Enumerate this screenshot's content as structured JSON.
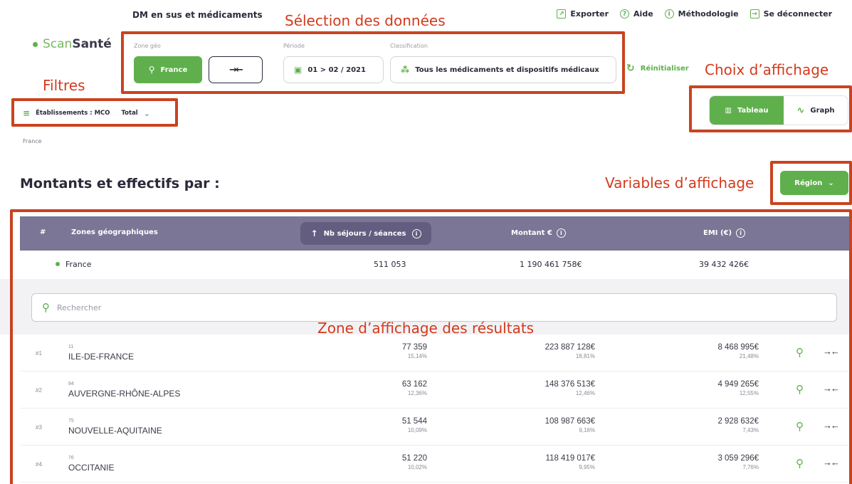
{
  "app": {
    "name": "DM en sus et médicaments",
    "logo_scan": "Scan",
    "logo_sante": "Santé"
  },
  "toplinks": [
    {
      "label": "Exporter",
      "icon": "export-icon"
    },
    {
      "label": "Aide",
      "icon": "help-icon"
    },
    {
      "label": "Méthodologie",
      "icon": "info-icon"
    },
    {
      "label": "Se déconnecter",
      "icon": "logout-icon"
    }
  ],
  "selection": {
    "zone_label": "Zone géo",
    "zone_value": "France",
    "period_label": "Période",
    "period_value": "01 > 02 / 2021",
    "classification_label": "Classification",
    "classification_value": "Tous les médicaments et dispositifs médicaux"
  },
  "reset_label": "Réinitialiser",
  "filters": {
    "establishments": "Établissements : MCO",
    "total": "Total"
  },
  "breadcrumb": "France",
  "view_toggle": {
    "table": "Tableau",
    "graph": "Graph",
    "active": "table"
  },
  "section_title": "Montants et effectifs par :",
  "variable_button": "Région",
  "table": {
    "headers": {
      "rank": "#",
      "zone": "Zones géographiques",
      "stays": "Nb séjours / séances",
      "amount": "Montant €",
      "emi": "EMI (€)"
    },
    "total_row": {
      "zone": "France",
      "stays": "511 053",
      "amount": "1 190 461 758€",
      "emi": "39 432 426€"
    },
    "search_placeholder": "Rechercher",
    "rows": [
      {
        "rank": "#1",
        "code": "11",
        "name": "ILE-DE-FRANCE",
        "stays": "77 359",
        "stays_pct": "15,14%",
        "amount": "223 887 128€",
        "amount_pct": "18,81%",
        "emi": "8 468 995€",
        "emi_pct": "21,48%"
      },
      {
        "rank": "#2",
        "code": "84",
        "name": "AUVERGNE-RHÔNE-ALPES",
        "stays": "63 162",
        "stays_pct": "12,36%",
        "amount": "148 376 513€",
        "amount_pct": "12,46%",
        "emi": "4 949 265€",
        "emi_pct": "12,55%"
      },
      {
        "rank": "#3",
        "code": "75",
        "name": "NOUVELLE-AQUITAINE",
        "stays": "51 544",
        "stays_pct": "10,09%",
        "amount": "108 987 663€",
        "amount_pct": "9,16%",
        "emi": "2 928 632€",
        "emi_pct": "7,43%"
      },
      {
        "rank": "#4",
        "code": "76",
        "name": "OCCITANIE",
        "stays": "51 220",
        "stays_pct": "10,02%",
        "amount": "118 419 017€",
        "amount_pct": "9,95%",
        "emi": "3 059 296€",
        "emi_pct": "7,76%"
      }
    ]
  },
  "annotations": {
    "selection": "Sélection des données",
    "filters": "Filtres",
    "display_choice": "Choix d’affichage",
    "display_variables": "Variables d’affichage",
    "results_zone": "Zone d’affichage des résultats"
  },
  "colors": {
    "accent": "#5fb04c",
    "header_bg": "#7b7596",
    "annotation": "#c9431f"
  }
}
